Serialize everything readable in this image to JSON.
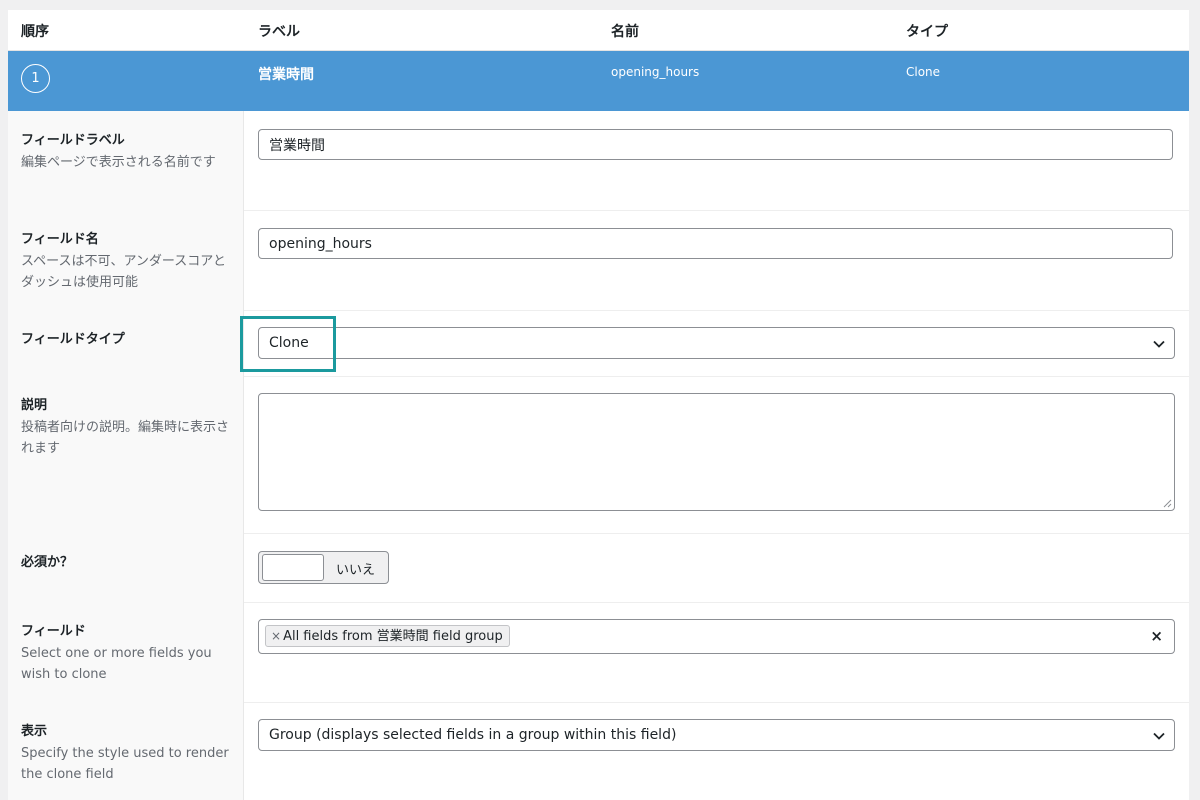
{
  "columns": {
    "order": "順序",
    "label": "ラベル",
    "name": "名前",
    "type": "タイプ"
  },
  "field_header": {
    "order": "1",
    "label": "営業時間",
    "name": "opening_hours",
    "type": "Clone"
  },
  "settings": {
    "field_label": {
      "title": "フィールドラベル",
      "desc": "編集ページで表示される名前です",
      "value": "営業時間"
    },
    "field_name": {
      "title": "フィールド名",
      "desc": "スペースは不可、アンダースコアとダッシュは使用可能",
      "value": "opening_hours"
    },
    "field_type": {
      "title": "フィールドタイプ",
      "value": "Clone"
    },
    "instructions": {
      "title": "説明",
      "desc": "投稿者向けの説明。編集時に表示されます",
      "value": ""
    },
    "required": {
      "title": "必須か？",
      "toggle_label": "いいえ"
    },
    "fields": {
      "title": "フィールド",
      "desc": "Select one or more fields you wish to clone",
      "chip_remove": "×",
      "chip": "All fields from 営業時間 field group",
      "clear": "×"
    },
    "display": {
      "title": "表示",
      "desc": "Specify the style used to render the clone field",
      "value": "Group (displays selected fields in a group within this field)"
    }
  },
  "colors": {
    "header_blue": "#4b97d4",
    "highlight_teal": "#1b9a9e"
  }
}
